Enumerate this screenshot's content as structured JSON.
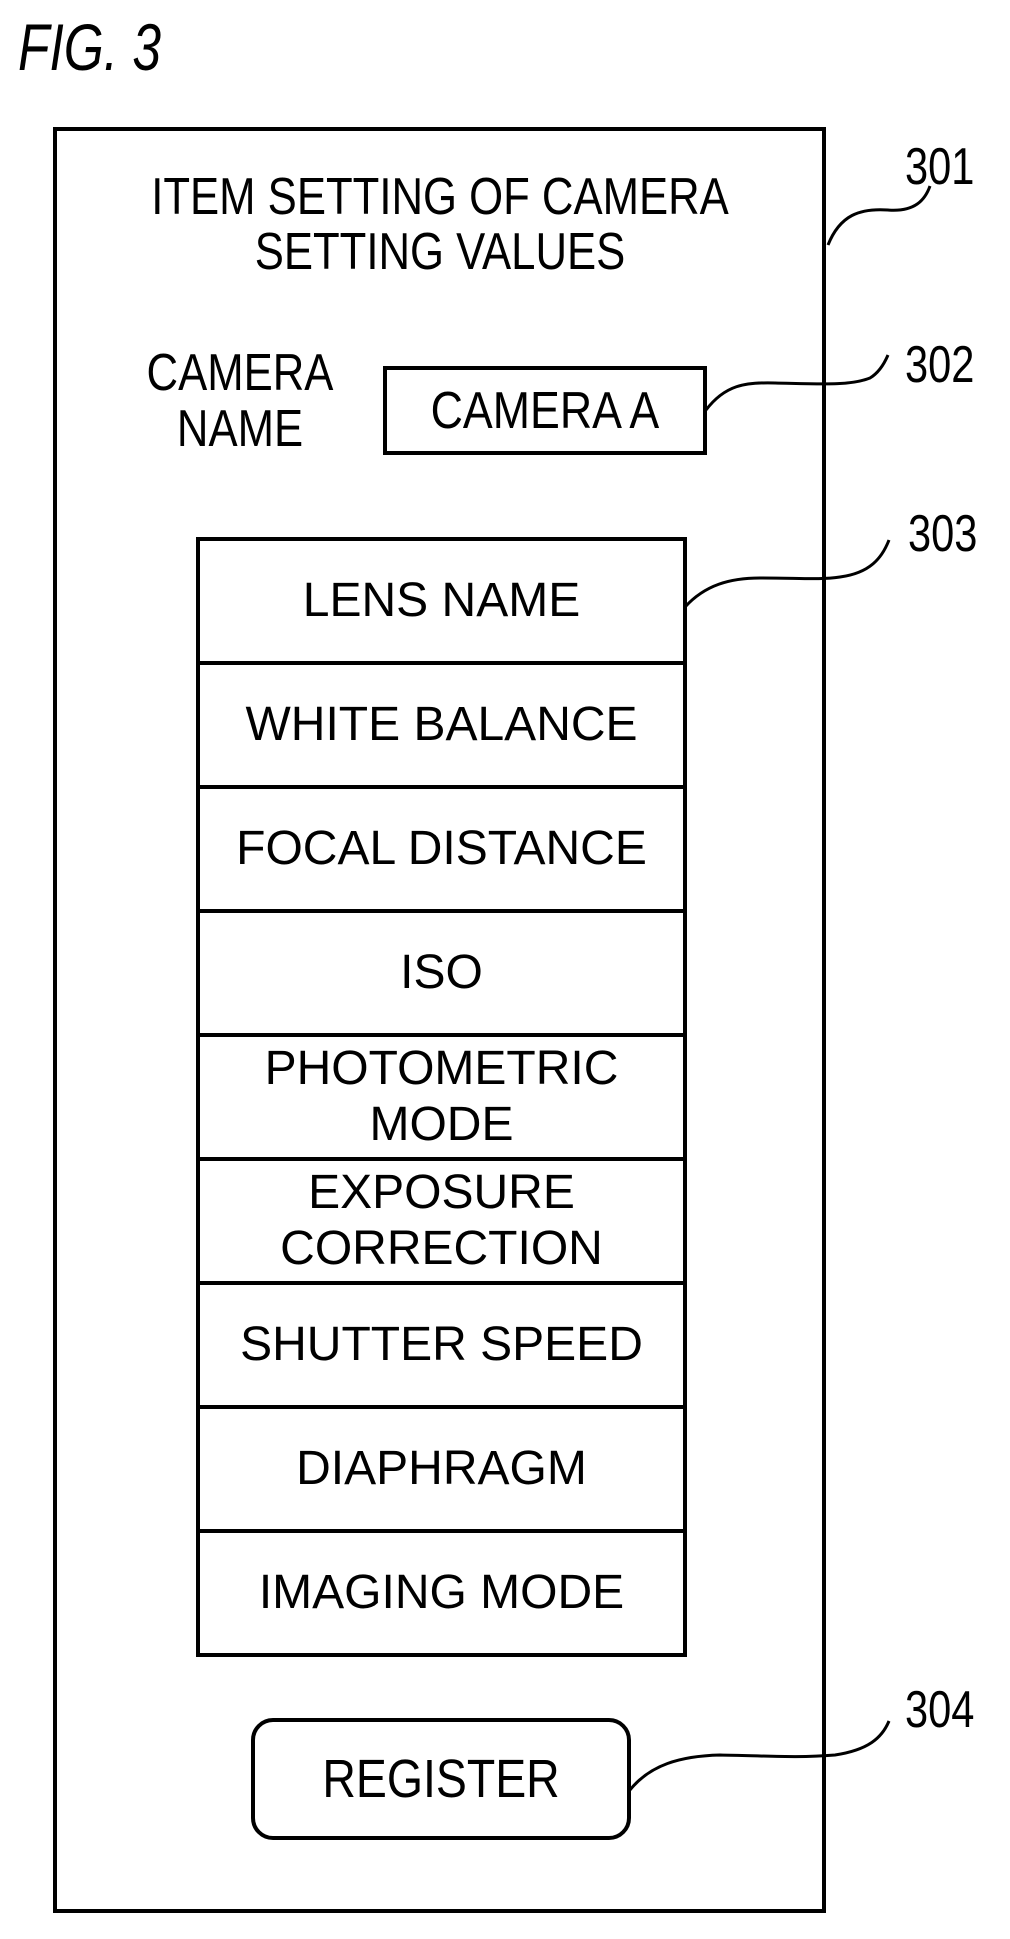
{
  "figure": {
    "label": "FIG. 3"
  },
  "screen": {
    "title_lines": [
      "ITEM SETTING OF CAMERA",
      "SETTING VALUES"
    ],
    "camera_name": {
      "label_lines": [
        "CAMERA",
        "NAME"
      ],
      "value": "CAMERA A"
    },
    "items": [
      {
        "label": "LENS NAME"
      },
      {
        "label": "WHITE BALANCE"
      },
      {
        "label": "FOCAL DISTANCE"
      },
      {
        "label": "ISO"
      },
      {
        "label": "PHOTOMETRIC\nMODE"
      },
      {
        "label": "EXPOSURE\nCORRECTION"
      },
      {
        "label": "SHUTTER SPEED"
      },
      {
        "label": "DIAPHRAGM"
      },
      {
        "label": "IMAGING MODE"
      }
    ],
    "register_button": {
      "label": "REGISTER"
    }
  },
  "reference_numerals": {
    "screen": "301",
    "camera_name_field": "302",
    "item_list": "303",
    "register_button": "304"
  },
  "colors": {
    "line": "#000000",
    "background": "#ffffff"
  }
}
